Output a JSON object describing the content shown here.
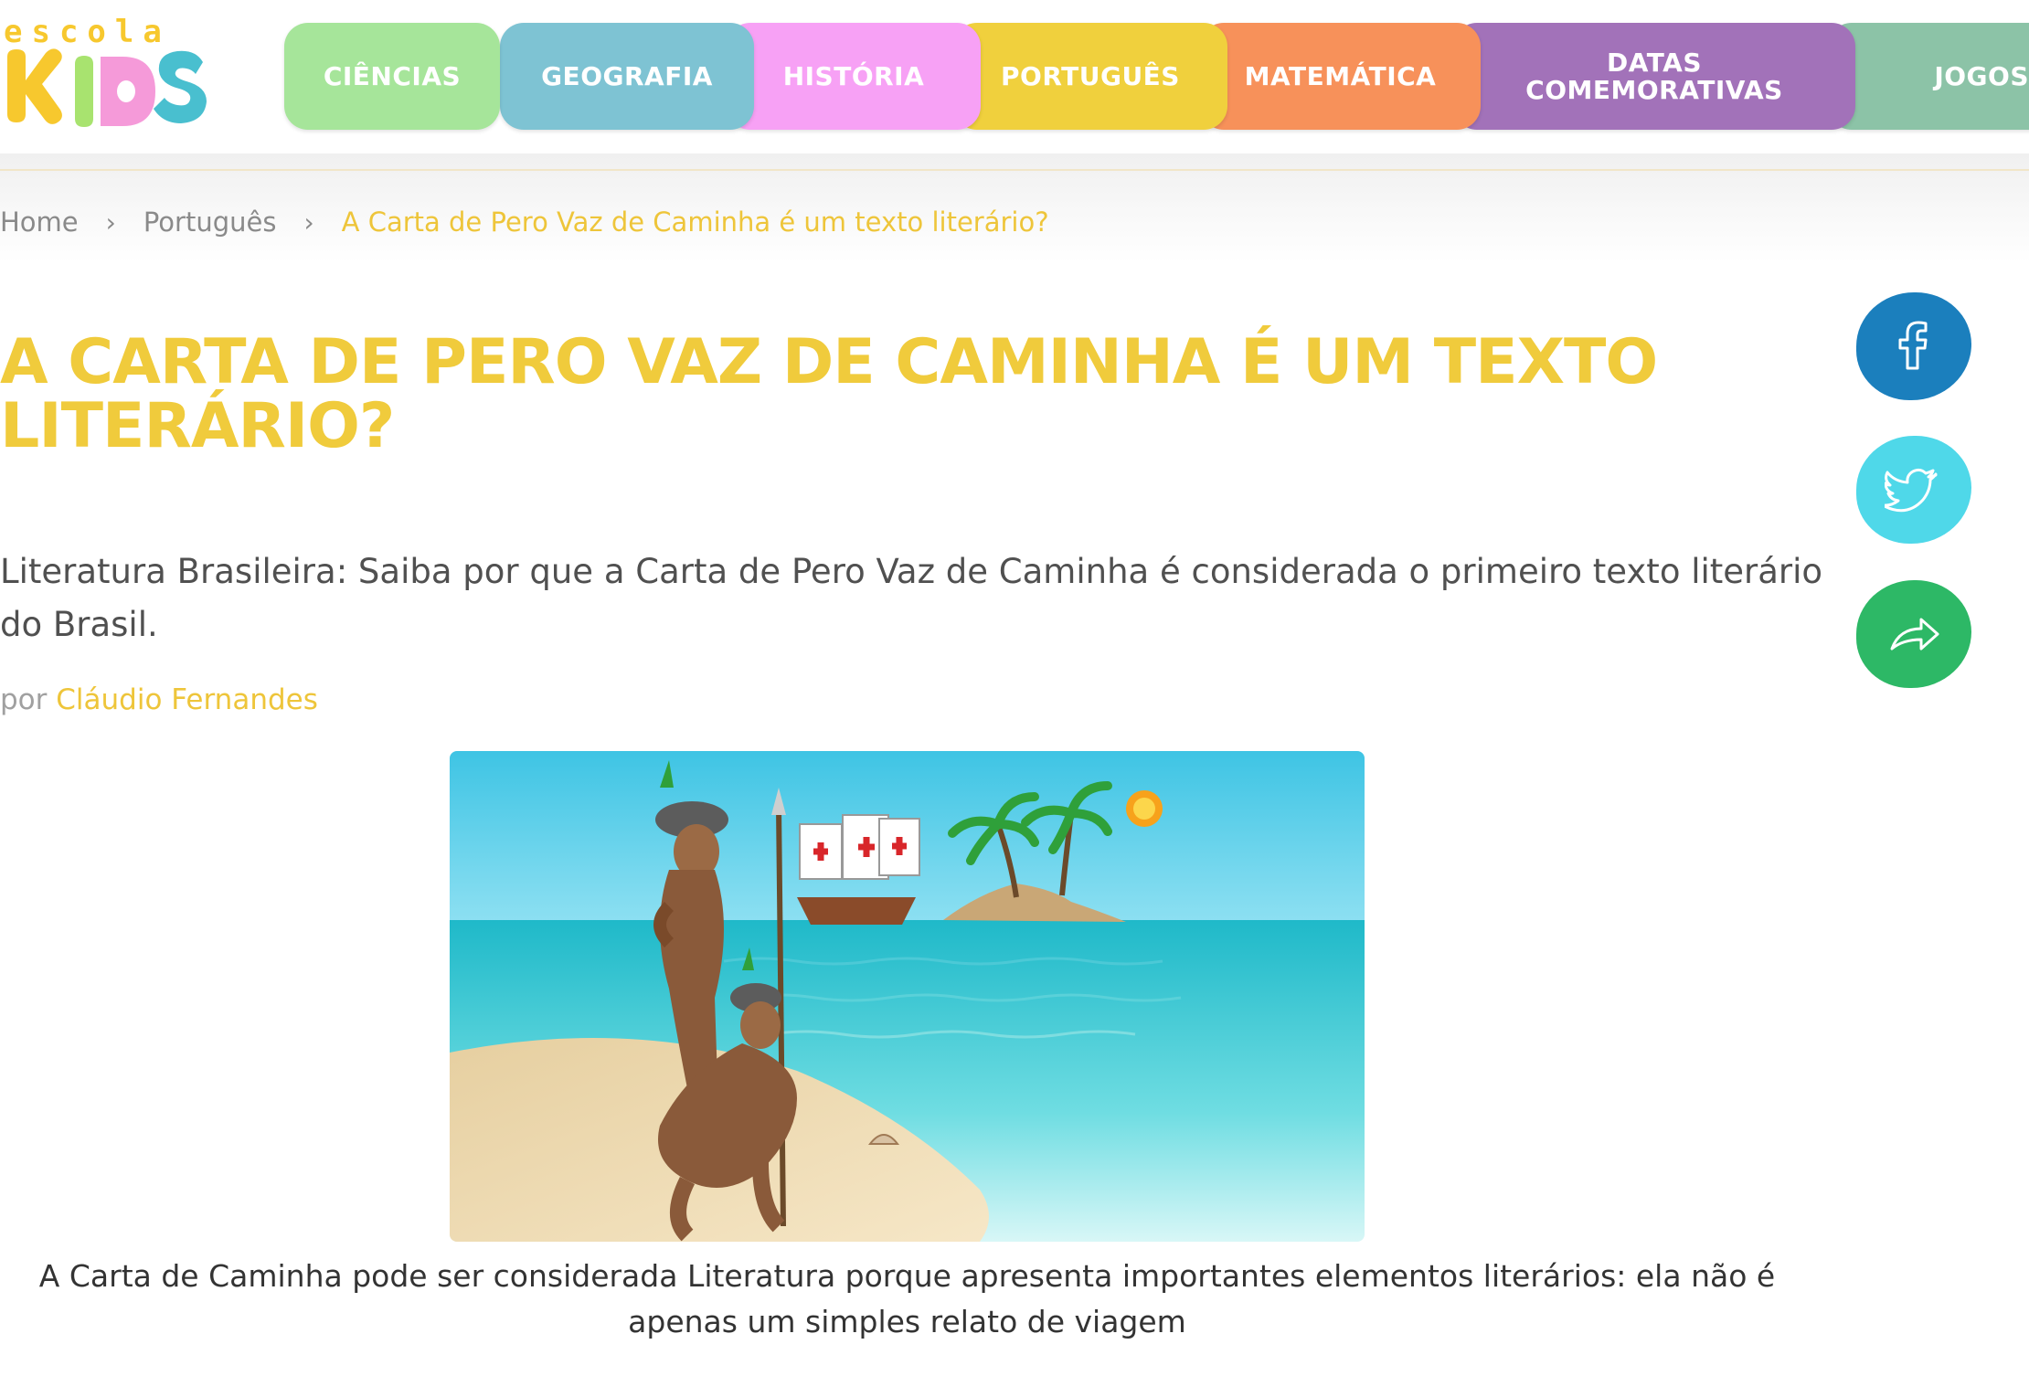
{
  "brand": {
    "escola_label": "escola",
    "kids_label": "KIDS",
    "colors": [
      "#f7c82e",
      "#a8e36f",
      "#f59ad9",
      "#49bfcf"
    ]
  },
  "nav": {
    "tabs": [
      {
        "label": "CIÊNCIAS",
        "color": "#a6e59a"
      },
      {
        "label": "GEOGRAFIA",
        "color": "#7ec3d3"
      },
      {
        "label": "HISTÓRIA",
        "color": "#f7a1f5"
      },
      {
        "label": "PORTUGUÊS",
        "color": "#f0d03d"
      },
      {
        "label": "MATEMÁTICA",
        "color": "#f7915a"
      },
      {
        "label": "DATAS COMEMORATIVAS",
        "color": "#a272b9"
      },
      {
        "label": "JOGOS",
        "color": "#8cc3a7"
      }
    ]
  },
  "breadcrumb": {
    "home": "Home",
    "separator": "›",
    "category": "Português",
    "current": "A Carta de Pero Vaz de Caminha é um texto literário?"
  },
  "article": {
    "title": "A CARTA DE PERO VAZ DE CAMINHA É UM TEXTO LITERÁRIO?",
    "subtitle": "Literatura Brasileira: Saiba por que a Carta de Pero Vaz de Caminha é considerada o primeiro texto literário do Brasil.",
    "author_prefix": "por",
    "author_name": "Cláudio Fernandes",
    "caption": "A Carta de Caminha pode ser considerada Literatura porque apresenta importantes elementos literários: ela não é apenas um simples relato de viagem"
  },
  "share": {
    "facebook": {
      "icon": "facebook-icon",
      "color": "#1b7fbd"
    },
    "twitter": {
      "icon": "twitter-icon",
      "color": "#4fd8e9"
    },
    "other": {
      "icon": "share-arrow-icon",
      "color": "#2db866"
    }
  },
  "colors": {
    "accent": "#f0cb3c",
    "text": "#505050"
  }
}
